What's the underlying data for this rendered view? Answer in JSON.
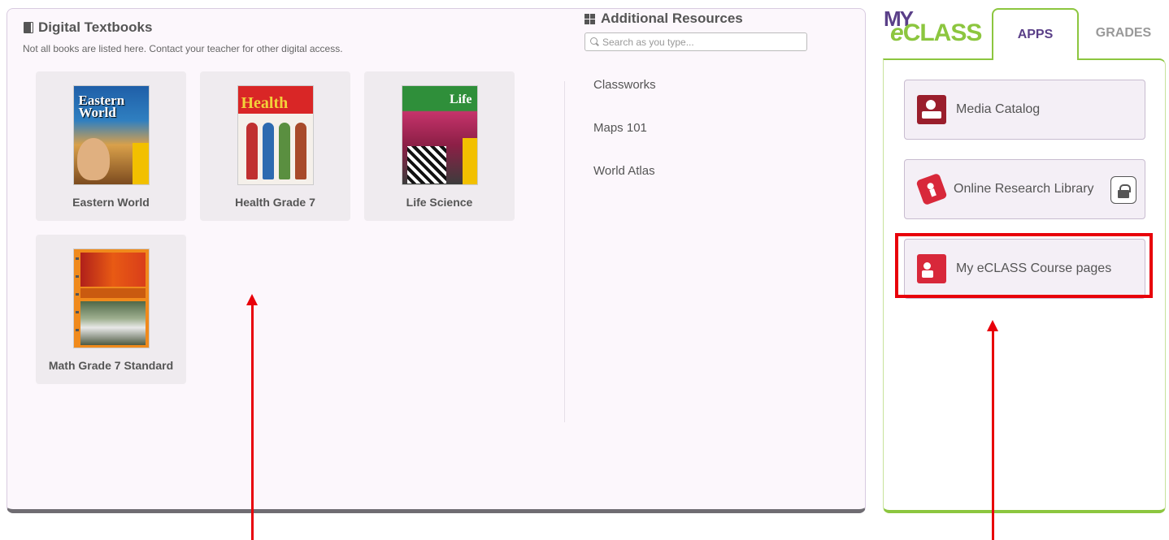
{
  "textbooks": {
    "title": "Digital Textbooks",
    "subtitle": "Not all books are listed here. Contact your teacher for other digital access.",
    "books": [
      {
        "title": "Eastern World",
        "cover_text": "Eastern World"
      },
      {
        "title": "Health Grade 7",
        "cover_text": "Health"
      },
      {
        "title": "Life Science",
        "cover_text": "Life"
      },
      {
        "title": "Math Grade 7 Standard",
        "cover_text": ""
      }
    ]
  },
  "resources": {
    "title": "Additional Resources",
    "search_placeholder": "Search as you type...",
    "items": [
      "Classworks",
      "Maps 101",
      "World Atlas"
    ]
  },
  "logo": {
    "my": "MY",
    "e": "e",
    "class": "CLASS"
  },
  "tabs": {
    "apps": "APPS",
    "grades": "GRADES"
  },
  "apps": [
    {
      "label": "Media Catalog",
      "icon": "media-catalog-icon"
    },
    {
      "label": "Online Research Library",
      "icon": "research-library-icon",
      "locked": true
    },
    {
      "label": "My eCLASS Course pages",
      "icon": "course-pages-icon",
      "highlighted": true
    }
  ],
  "colors": {
    "brand_purple": "#5a3f88",
    "brand_green": "#8cc63f",
    "annotation_red": "#e8000a",
    "app_icon_red": "#d8283a"
  }
}
